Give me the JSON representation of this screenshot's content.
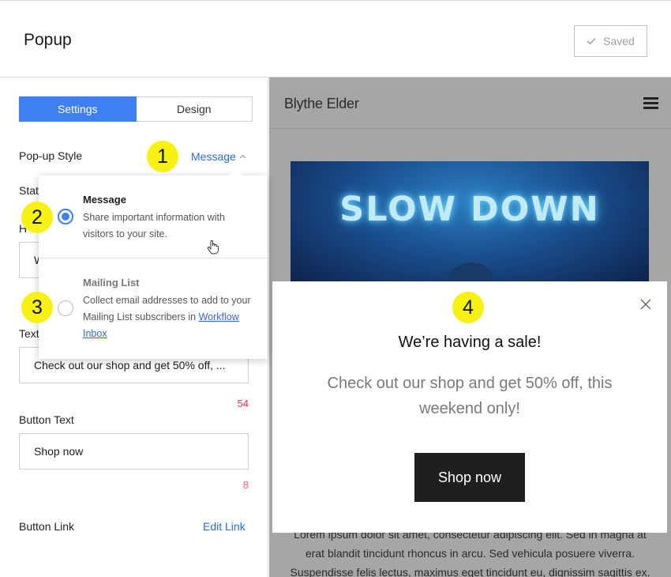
{
  "header": {
    "title": "Popup",
    "saved_label": "Saved"
  },
  "tabs": {
    "settings": "Settings",
    "design": "Design"
  },
  "settings": {
    "popup_style_label": "Pop-up Style",
    "popup_style_value": "Message",
    "status_label_clipped": "Stat",
    "headline_label_clipped": "H",
    "headline_value_clipped": "W",
    "text_label_clipped": "Text",
    "text_value": "Check out our shop and get 50% off,  ...",
    "text_counter": "54",
    "button_text_label": "Button Text",
    "button_text_value": "Shop now",
    "button_text_counter": "8",
    "button_link_label": "Button Link",
    "edit_link_label": "Edit Link"
  },
  "dropdown": {
    "options": [
      {
        "title": "Message",
        "description": "Share important information with visitors to your site.",
        "selected": true
      },
      {
        "title": "Mailing List",
        "description": "Collect email addresses to add to your Mailing List subscribers in ",
        "link": "Workflow Inbox",
        "selected": false
      }
    ]
  },
  "preview": {
    "site_title": "Blythe Elder",
    "hero_text": "SLOW DOWN",
    "popup_title": "We’re having a sale!",
    "popup_message": "Check out our shop and get 50% off, this weekend only!",
    "popup_button": "Shop now",
    "body_text": "Lorem ipsum dolor sit amet, consectetur adipiscing elit. Sed in magna at erat blandit tincidunt rhoncus in arcu. Sed vehicula posuere viverra. Suspendisse felis lectus, maximus eget tincidunt eu, dignissim sagittis ex. Sed ac mattis"
  },
  "markers": [
    "1",
    "2",
    "3",
    "4"
  ],
  "colors": {
    "accent": "#3e7ff2",
    "link": "#2c6bd8",
    "counter": "#e8344e",
    "marker": "#f7f114",
    "preview_bg": "#a6a6a6"
  },
  "icons": [
    "check-icon",
    "chevron-up-icon",
    "pointer-hand-icon",
    "hamburger-menu-icon",
    "close-icon"
  ]
}
